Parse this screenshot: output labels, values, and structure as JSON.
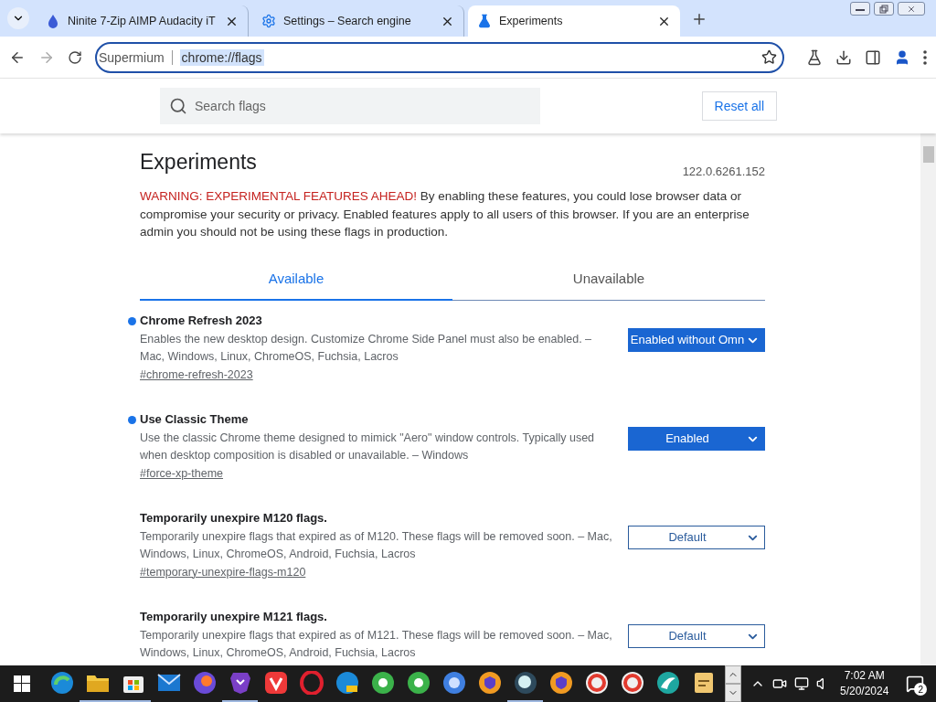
{
  "tabs": [
    {
      "title": "Ninite 7-Zip AIMP Audacity iT",
      "selected": false
    },
    {
      "title": "Settings – Search engine",
      "selected": false
    },
    {
      "title": "Experiments",
      "selected": true
    }
  ],
  "omnibox": {
    "chip": "Supermium",
    "url": "chrome://flags"
  },
  "search": {
    "placeholder": "Search flags"
  },
  "reset_button": "Reset all",
  "page": {
    "title": "Experiments",
    "version": "122.0.6261.152",
    "warning": "WARNING: EXPERIMENTAL FEATURES AHEAD!",
    "intro": "By enabling these features, you could lose browser data or compromise your security or privacy. Enabled features apply to all users of this browser. If you are an enterprise admin you should not be using these flags in production."
  },
  "page_tabs": [
    {
      "label": "Available",
      "selected": true
    },
    {
      "label": "Unavailable",
      "selected": false
    }
  ],
  "flags": [
    {
      "name": "Chrome Refresh 2023",
      "description": "Enables the new desktop design. Customize Chrome Side Panel must also be enabled. – Mac, Windows, Linux, ChromeOS, Fuchsia, Lacros",
      "link": "#chrome-refresh-2023",
      "value": "Enabled without Omn",
      "modified": true
    },
    {
      "name": "Use Classic Theme",
      "description": "Use the classic Chrome theme designed to mimick \"Aero\" window controls. Typically used when desktop composition is disabled or unavailable. – Windows",
      "link": "#force-xp-theme",
      "value": "Enabled",
      "modified": true
    },
    {
      "name": "Temporarily unexpire M120 flags.",
      "description": "Temporarily unexpire flags that expired as of M120. These flags will be removed soon. – Mac, Windows, Linux, ChromeOS, Android, Fuchsia, Lacros",
      "link": "#temporary-unexpire-flags-m120",
      "value": "Default",
      "modified": false
    },
    {
      "name": "Temporarily unexpire M121 flags.",
      "description": "Temporarily unexpire flags that expired as of M121. These flags will be removed soon. – Mac, Windows, Linux, ChromeOS, Android, Fuchsia, Lacros",
      "value": "Default",
      "modified": false
    }
  ],
  "taskbar": {
    "apps": [
      {
        "kind": "edge",
        "running": false
      },
      {
        "kind": "folder",
        "running": true
      },
      {
        "kind": "store",
        "running": true
      },
      {
        "kind": "mail",
        "running": false
      },
      {
        "kind": "firefox",
        "running": false
      },
      {
        "kind": "brave",
        "running": true
      },
      {
        "kind": "vivaldi",
        "running": false
      },
      {
        "kind": "opera",
        "running": false
      },
      {
        "kind": "edge-can",
        "running": false
      },
      {
        "kind": "green",
        "running": false
      },
      {
        "kind": "green",
        "running": false
      },
      {
        "kind": "chromium",
        "running": false
      },
      {
        "kind": "shield",
        "running": false
      },
      {
        "kind": "globe",
        "running": true
      },
      {
        "kind": "shield",
        "running": false
      },
      {
        "kind": "red",
        "running": false
      },
      {
        "kind": "red",
        "running": false
      },
      {
        "kind": "teal",
        "running": false
      },
      {
        "kind": "notes",
        "running": false
      }
    ],
    "time": "7:02 AM",
    "date": "5/20/2024",
    "notifications": "2"
  }
}
